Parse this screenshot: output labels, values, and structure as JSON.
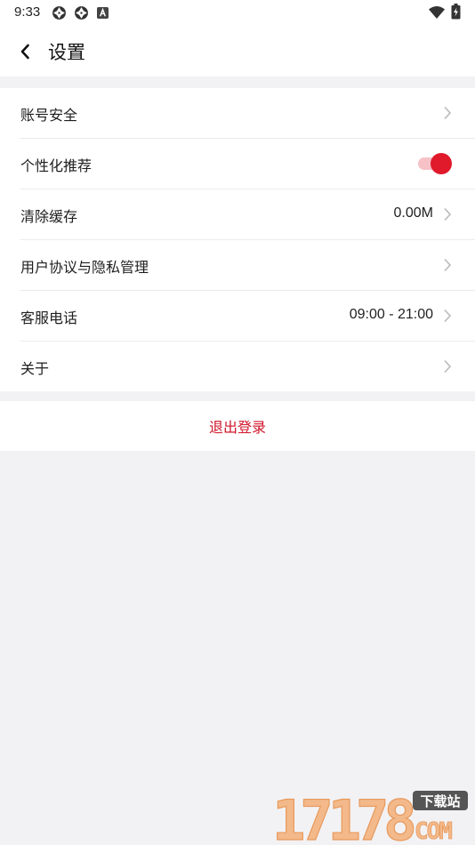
{
  "status_bar": {
    "time": "9:33",
    "icons": [
      "aperture-icon",
      "aperture-icon",
      "text-a-icon",
      "wifi-icon",
      "battery-icon"
    ]
  },
  "header": {
    "title": "设置",
    "back_icon": "chevron-left-icon"
  },
  "settings": {
    "items": [
      {
        "label": "账号安全",
        "value": "",
        "control": "chevron"
      },
      {
        "label": "个性化推荐",
        "value": "",
        "control": "toggle",
        "toggle_on": true
      },
      {
        "label": "清除缓存",
        "value": "0.00M",
        "control": "chevron"
      },
      {
        "label": "用户协议与隐私管理",
        "value": "",
        "control": "chevron"
      },
      {
        "label": "客服电话",
        "value": "09:00 - 21:00",
        "control": "chevron"
      },
      {
        "label": "关于",
        "value": "",
        "control": "chevron"
      }
    ]
  },
  "logout": {
    "label": "退出登录"
  },
  "watermark": {
    "number": "17178",
    "badge": "下载站",
    "suffix": "COM"
  },
  "colors": {
    "accent": "#e0192b",
    "logout_text": "#d0152a",
    "background": "#f2f2f4",
    "watermark": "#f3b98a"
  }
}
